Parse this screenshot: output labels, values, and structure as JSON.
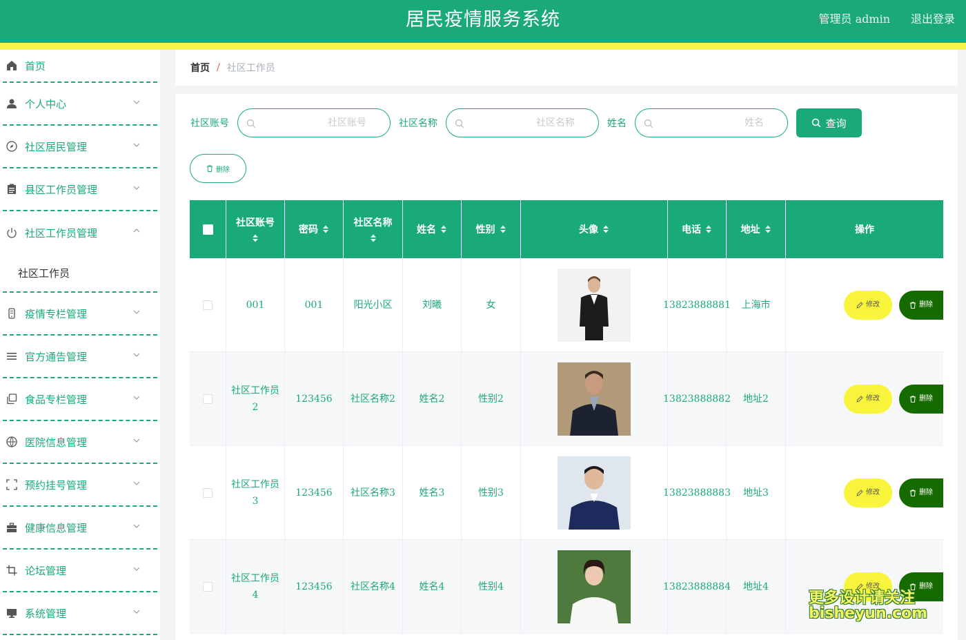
{
  "header": {
    "title": "居民疫情服务系统",
    "user": "管理员 admin",
    "logout": "退出登录"
  },
  "colors": {
    "primary": "#1aaa7a",
    "accent_yellow": "#f5f549",
    "delete_dark": "#166b00"
  },
  "sidebar": {
    "home": "首页",
    "items": [
      {
        "label": "个人中心",
        "icon": "user-icon"
      },
      {
        "label": "社区居民管理",
        "icon": "compass-icon"
      },
      {
        "label": "县区工作员管理",
        "icon": "clipboard-icon"
      },
      {
        "label": "社区工作员管理",
        "icon": "power-icon",
        "expanded": true,
        "sub": "社区工作员"
      },
      {
        "label": "疫情专栏管理",
        "icon": "phone-icon"
      },
      {
        "label": "官方通告管理",
        "icon": "list-icon"
      },
      {
        "label": "食品专栏管理",
        "icon": "copy-icon"
      },
      {
        "label": "医院信息管理",
        "icon": "globe-icon"
      },
      {
        "label": "预约挂号管理",
        "icon": "frame-icon"
      },
      {
        "label": "健康信息管理",
        "icon": "briefcase-icon"
      },
      {
        "label": "论坛管理",
        "icon": "crop-icon"
      },
      {
        "label": "系统管理",
        "icon": "monitor-icon"
      }
    ]
  },
  "breadcrumb": {
    "home": "首页",
    "separator": "/",
    "current": "社区工作员"
  },
  "search": {
    "account_label": "社区账号",
    "account_placeholder": "社区账号",
    "community_label": "社区名称",
    "community_placeholder": "社区名称",
    "name_label": "姓名",
    "name_placeholder": "姓名",
    "query_label": "查询"
  },
  "bulk_delete_label": "删除",
  "table": {
    "headers": {
      "account": "社区账号",
      "password": "密码",
      "community": "社区名称",
      "name": "姓名",
      "gender": "性别",
      "avatar": "头像",
      "phone": "电话",
      "address": "地址",
      "action": "操作"
    },
    "edit_label": "修改",
    "delete_label": "删除",
    "rows": [
      {
        "account": "001",
        "password": "001",
        "community": "阳光小区",
        "name": "刘曦",
        "gender": "女",
        "phone": "13823888881",
        "address": "上海市"
      },
      {
        "account": "社区工作员2",
        "password": "123456",
        "community": "社区名称2",
        "name": "姓名2",
        "gender": "性别2",
        "phone": "13823888882",
        "address": "地址2"
      },
      {
        "account": "社区工作员3",
        "password": "123456",
        "community": "社区名称3",
        "name": "姓名3",
        "gender": "性别3",
        "phone": "13823888883",
        "address": "地址3"
      },
      {
        "account": "社区工作员4",
        "password": "123456",
        "community": "社区名称4",
        "name": "姓名4",
        "gender": "性别4",
        "phone": "13823888884",
        "address": "地址4"
      }
    ]
  },
  "watermark": {
    "line1": "更多设计请关注",
    "line2": "bisheyun.com"
  }
}
